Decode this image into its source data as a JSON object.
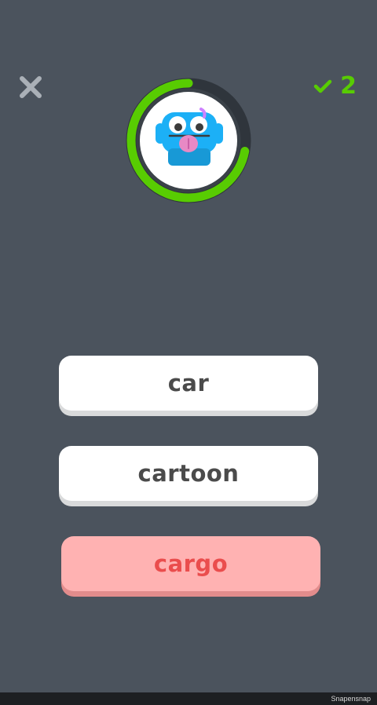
{
  "header": {
    "close_icon": "close-icon",
    "score_icon": "checkmark-icon",
    "score_value": "2"
  },
  "timer": {
    "avatar_icon": "blue-monster-avatar-icon",
    "progress_fraction": 0.72,
    "colors": {
      "progress": "#58cc02",
      "track": "#3a4148",
      "avatar_body": "#1cb0f6"
    }
  },
  "choices": [
    {
      "label": "car",
      "state": "default"
    },
    {
      "label": "cartoon",
      "state": "default"
    },
    {
      "label": "cargo",
      "state": "incorrect"
    }
  ],
  "footer": {
    "watermark": "Snapensnap"
  },
  "colors": {
    "background": "#4b535d",
    "accent_green": "#58cc02",
    "wrong_bg": "#ffb2b2",
    "wrong_text": "#ea4d4d"
  }
}
